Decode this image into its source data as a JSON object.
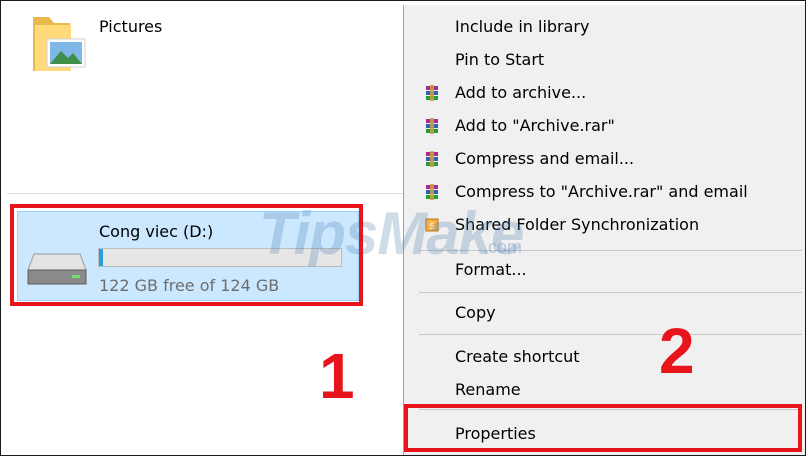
{
  "explorer": {
    "pictures_label": "Pictures",
    "drive": {
      "name": "Cong viec (D:)",
      "space_text": "122 GB free of 124 GB",
      "used_fraction": 0.016
    }
  },
  "context_menu": {
    "items": [
      {
        "label": "Include in library",
        "icon": ""
      },
      {
        "label": "Pin to Start",
        "icon": ""
      },
      {
        "label": "Add to archive...",
        "icon": "winrar-icon"
      },
      {
        "label": "Add to \"Archive.rar\"",
        "icon": "winrar-icon"
      },
      {
        "label": "Compress and email...",
        "icon": "winrar-icon"
      },
      {
        "label": "Compress to \"Archive.rar\" and email",
        "icon": "winrar-icon"
      },
      {
        "label": "Shared Folder Synchronization",
        "icon": "sync-folder-icon"
      },
      {
        "label": "Format...",
        "icon": ""
      },
      {
        "label": "Copy",
        "icon": ""
      },
      {
        "label": "Create shortcut",
        "icon": ""
      },
      {
        "label": "Rename",
        "icon": ""
      },
      {
        "label": "Properties",
        "icon": ""
      }
    ]
  },
  "callouts": {
    "one": "1",
    "two": "2"
  },
  "watermark": {
    "text": "TipsMake",
    "suffix": ".com"
  },
  "colors": {
    "highlight": "#e8141b",
    "selection": "#cce8ff",
    "bar_fill": "#26a0da"
  }
}
